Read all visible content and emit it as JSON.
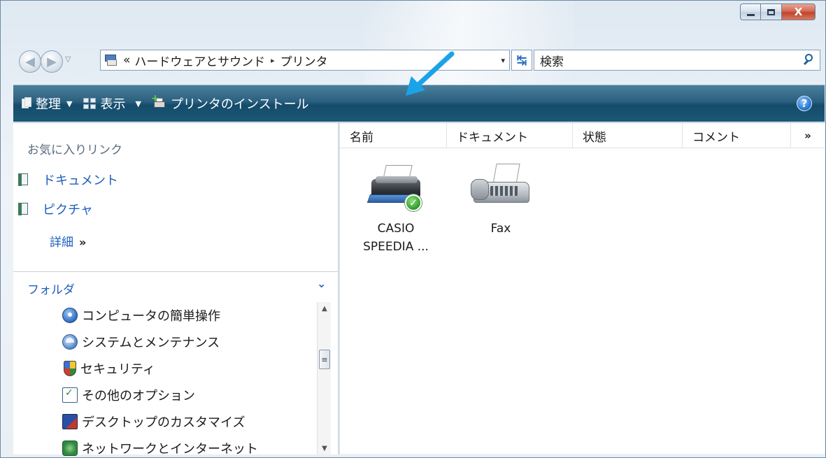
{
  "window": {
    "caption": {
      "minimize": "",
      "maximize": "",
      "close": "X"
    }
  },
  "address": {
    "chevron": "«",
    "crumbs": [
      "ハードウェアとサウンド",
      "プリンタ"
    ],
    "separator": "▸",
    "dropdown": "▾",
    "refresh_icon": "refresh-icon",
    "search_placeholder": "検索"
  },
  "toolbar": {
    "organize_label": "整理",
    "view_label": "表示",
    "install_printer_label": "プリンタのインストール",
    "caret": "▼",
    "help_label": "?"
  },
  "nav_pane": {
    "favorites_header": "お気に入りリンク",
    "favorites": [
      {
        "label": "ドキュメント",
        "icon": "documents-icon"
      },
      {
        "label": "ピクチャ",
        "icon": "pictures-icon"
      }
    ],
    "more_label": "詳細",
    "more_chevron": "»",
    "folders_header": "フォルダ",
    "folders_collapse": "⌄",
    "tree": [
      {
        "label": "コンピュータの簡単操作",
        "icon": "ease-of-access-icon"
      },
      {
        "label": "システムとメンテナンス",
        "icon": "system-maintenance-icon"
      },
      {
        "label": "セキュリティ",
        "icon": "security-shield-icon"
      },
      {
        "label": "その他のオプション",
        "icon": "additional-options-icon"
      },
      {
        "label": "デスクトップのカスタマイズ",
        "icon": "desktop-customize-icon"
      },
      {
        "label": "ネットワークとインターネット",
        "icon": "network-internet-icon"
      }
    ],
    "scrollbar": {
      "up": "▲",
      "down": "▼",
      "thumb": "≡"
    }
  },
  "file_list": {
    "columns": [
      "名前",
      "ドキュメント",
      "状態",
      "コメント",
      "»"
    ],
    "items": [
      {
        "label_line1": "CASIO",
        "label_line2": "SPEEDIA ...",
        "icon": "printer-default-icon"
      },
      {
        "label_line1": "Fax",
        "label_line2": "",
        "icon": "fax-icon"
      }
    ]
  },
  "colors": {
    "toolbar": "#1d5877",
    "link": "#1f5fbf",
    "annotation_arrow": "#1aa3e8"
  }
}
